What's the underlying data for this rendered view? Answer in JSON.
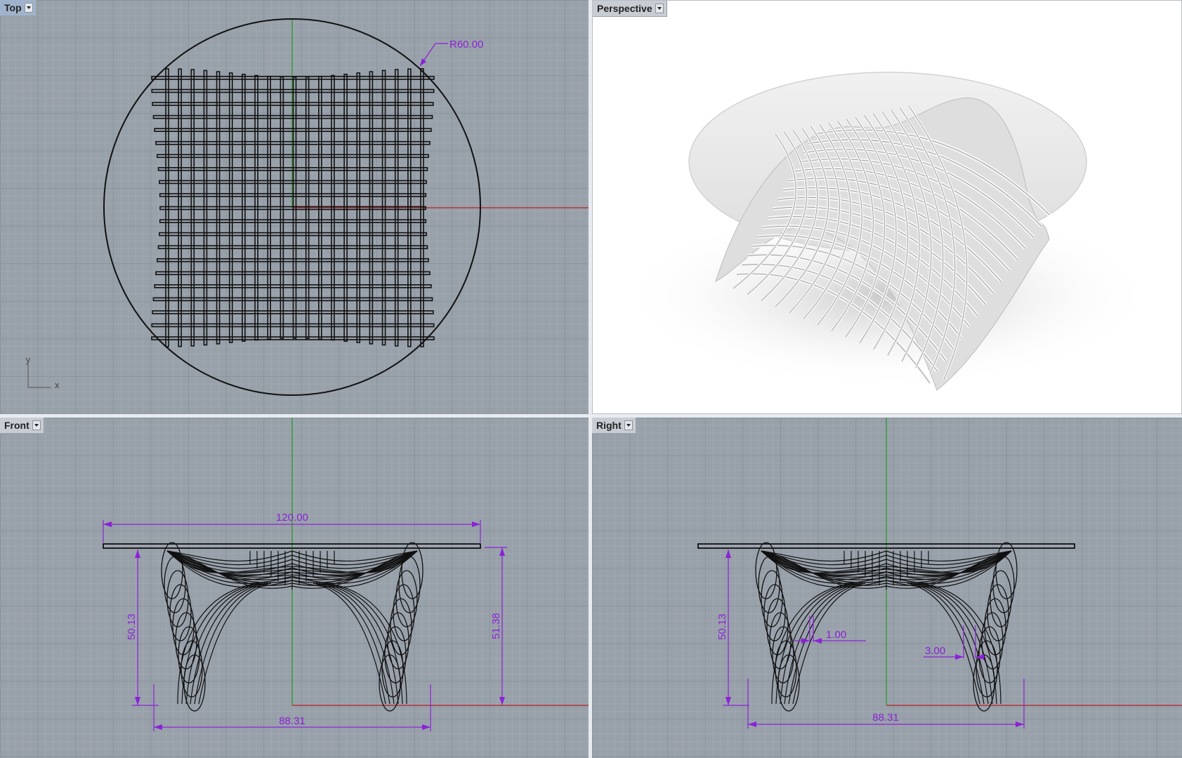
{
  "viewports": {
    "top": {
      "label": "Top"
    },
    "perspective": {
      "label": "Perspective"
    },
    "front": {
      "label": "Front"
    },
    "right": {
      "label": "Right"
    }
  },
  "dimensions": {
    "top_radius": "R60.00",
    "front_width": "120.00",
    "front_base_width": "88.31",
    "front_left_height": "50.13",
    "front_right_height": "51.38",
    "right_base_width": "88.31",
    "right_left_height": "50.13",
    "right_slot_gap": "1.00",
    "right_slot_width": "3.00"
  },
  "axis_labels": {
    "y": "y",
    "x": "x"
  },
  "colors": {
    "grid_bg": "#98a0aa",
    "dimension": "#8b22d6",
    "x_axis": "#b52020",
    "y_axis": "#1e9a1e",
    "active_tab": "#9fb3cc"
  }
}
